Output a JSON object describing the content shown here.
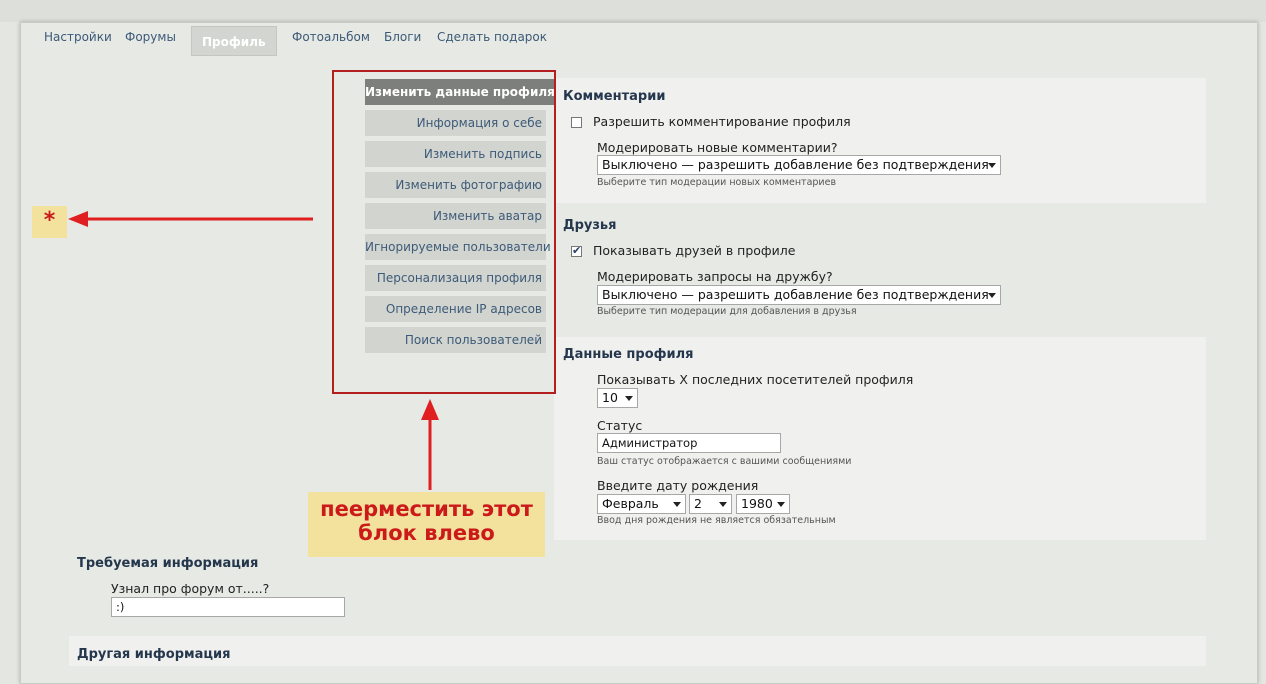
{
  "tabs": [
    "Настройки",
    "Форумы",
    "Профиль",
    "Фотоальбом",
    "Блоги",
    "Сделать подарок"
  ],
  "active_tab": "Профиль",
  "menu": [
    "Изменить данные профиля",
    "Информация о себе",
    "Изменить подпись",
    "Изменить фотографию",
    "Изменить аватар",
    "Игнорируемые пользователи",
    "Персонализация профиля",
    "Определение IP адресов",
    "Поиск пользователей"
  ],
  "comments": {
    "title": "Комментарии",
    "allow_label": "Разрешить комментирование профиля",
    "allow_checked": false,
    "moderate_label": "Модерировать новые комментарии?",
    "moderate_value": "Выключено — разрешить добавление без подтверждения",
    "moderate_hint": "Выберите тип модерации новых комментариев"
  },
  "friends": {
    "title": "Друзья",
    "show_label": "Показывать друзей в профиле",
    "show_checked": true,
    "moderate_label": "Модерировать запросы на дружбу?",
    "moderate_value": "Выключено — разрешить добавление без подтверждения",
    "moderate_hint": "Выберите тип модерации для добавления в друзья"
  },
  "profile_data": {
    "title": "Данные профиля",
    "visitors_label": "Показывать X последних посетителей профиля",
    "visitors_value": "10",
    "status_label": "Статус",
    "status_value": "Администратор",
    "status_hint": "Ваш статус отображается с вашими сообщениями",
    "birthday_label": "Введите дату рождения",
    "birthday_month": "Февраль",
    "birthday_day": "2",
    "birthday_year": "1980",
    "birthday_hint": "Ввод дня рождения не является обязательным"
  },
  "required": {
    "title": "Требуемая информация",
    "question_label": "Узнал про форум от.....?",
    "question_value": ":)"
  },
  "other": {
    "title": "Другая информация"
  },
  "annotations": {
    "star": "*",
    "note_line1": "пеерместить этот",
    "note_line2": "блок влево",
    "color": "#cc1a1a"
  }
}
